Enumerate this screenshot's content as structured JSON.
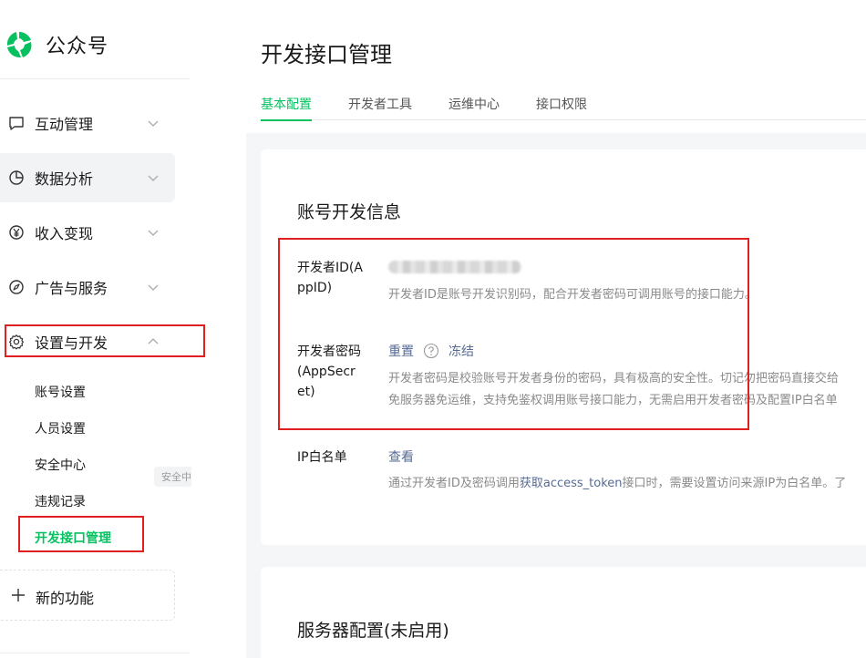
{
  "app": {
    "name": "公众号"
  },
  "sidebar": {
    "items": [
      {
        "label": "互动管理",
        "icon": "chat-icon"
      },
      {
        "label": "数据分析",
        "icon": "pie-chart-icon"
      },
      {
        "label": "收入变现",
        "icon": "yen-icon"
      },
      {
        "label": "广告与服务",
        "icon": "compass-icon"
      },
      {
        "label": "设置与开发",
        "icon": "gear-icon"
      }
    ],
    "sub_items": [
      "账号设置",
      "人员设置",
      "安全中心",
      "违规记录",
      "开发接口管理"
    ],
    "tooltip": "安全中心",
    "new_feature": "新的功能"
  },
  "main": {
    "title": "开发接口管理",
    "tabs": [
      "基本配置",
      "开发者工具",
      "运维中心",
      "接口权限"
    ],
    "section1": {
      "title": "账号开发信息",
      "appid_label": "开发者ID(AppID)",
      "appid_desc": "开发者ID是账号开发识别码，配合开发者密码可调用账号的接口能力。",
      "secret_label": "开发者密码(AppSecret)",
      "reset": "重置",
      "freeze": "冻结",
      "secret_desc1": "开发者密码是校验账号开发者身份的密码，具有极高的安全性。切记勿把密码直接交给",
      "secret_desc2": "免服务器免运维，支持免鉴权调用账号接口能力，无需启用开发者密码及配置IP白名单",
      "ip_label": "IP白名单",
      "ip_view": "查看",
      "ip_desc_pre": "通过开发者ID及密码调用",
      "ip_desc_link": "获取access_token",
      "ip_desc_post": "接口时，需要设置访问来源IP为白名单。了"
    },
    "section2": {
      "title": "服务器配置(未启用)"
    }
  },
  "colors": {
    "accent": "#07c160",
    "link": "#576b95",
    "highlight": "#e02020"
  }
}
